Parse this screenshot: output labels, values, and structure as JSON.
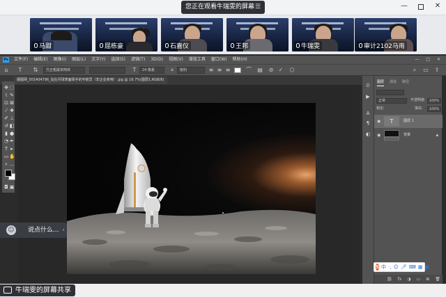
{
  "meeting": {
    "watching_text": "您正在观看牛瑞雯的屏幕",
    "menu_icon": "menu-icon",
    "window_controls": [
      "minimize",
      "maximize",
      "close"
    ],
    "share_status": "牛瑞雯的屏幕共享",
    "chat_placeholder": "说点什么...",
    "participants": [
      {
        "name": "马甜"
      },
      {
        "name": "屈栋豪"
      },
      {
        "name": "石嘉仪"
      },
      {
        "name": "王邦"
      },
      {
        "name": "牛瑞雯"
      },
      {
        "name": "审计2102马雨"
      }
    ]
  },
  "photoshop": {
    "logo": "Ps",
    "menus": [
      "文件(F)",
      "编辑(E)",
      "图像(I)",
      "图层(L)",
      "文字(Y)",
      "选择(S)",
      "滤镜(T)",
      "3D(D)",
      "视图(V)",
      "增效工具",
      "窗口(W)",
      "帮助(H)"
    ],
    "options": {
      "font_family": "方正粗黑宋简体",
      "font_size": "24 像素",
      "aa": "a",
      "aa_mode": "锐利"
    },
    "document_tab": "摄图网_501404796_站在月球表面挥手的宇航员（非企业商用）.jpg @ 16.7%(图层1,RGB/8)",
    "panels": {
      "tabs": [
        "图层",
        "通道",
        "路径"
      ],
      "blend_mode": "正常",
      "opacity_label": "不透明度:",
      "opacity_value": "100%",
      "lock_label": "锁定:",
      "fill_label": "填充:",
      "fill_value": "100%",
      "layers": [
        {
          "name": "图层 1",
          "type": "text",
          "selected": true
        },
        {
          "name": "背景",
          "type": "image",
          "selected": false
        }
      ]
    }
  },
  "ime": {
    "label": "中"
  }
}
